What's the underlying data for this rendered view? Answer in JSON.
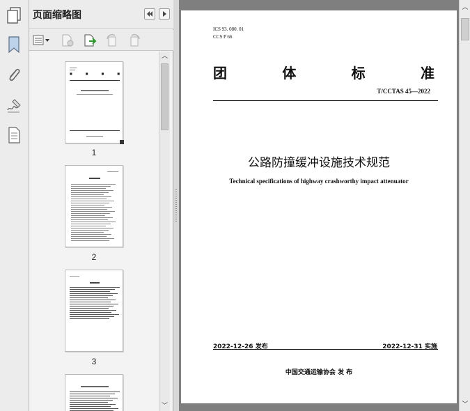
{
  "panel": {
    "title": "页面缩略图"
  },
  "left_rail": {
    "icons": [
      "pages-icon",
      "bookmark-icon",
      "attachment-icon",
      "signature-icon",
      "document-icon"
    ]
  },
  "panel_toolbar": {
    "icons": [
      "thumbnail-options-icon",
      "delete-page-icon",
      "insert-page-icon",
      "rotate-left-icon",
      "rotate-right-icon"
    ]
  },
  "thumbnails": [
    {
      "page": "1"
    },
    {
      "page": "2"
    },
    {
      "page": "3"
    }
  ],
  "page": {
    "ics": "ICS 93. 080. 01",
    "ccs": "CCS  P  66",
    "group_chars": [
      "团",
      "体",
      "标",
      "准"
    ],
    "code": "T/CCTAS  45—2022",
    "title_cn": "公路防撞缓冲设施技术规范",
    "title_en": "Technical specifications of highway crashworthy impact attenuator",
    "publish_date": "2022-12-26 发布",
    "effective_date": "2022-12-31 实施",
    "publisher": "中国交通运输协会    发  布"
  }
}
